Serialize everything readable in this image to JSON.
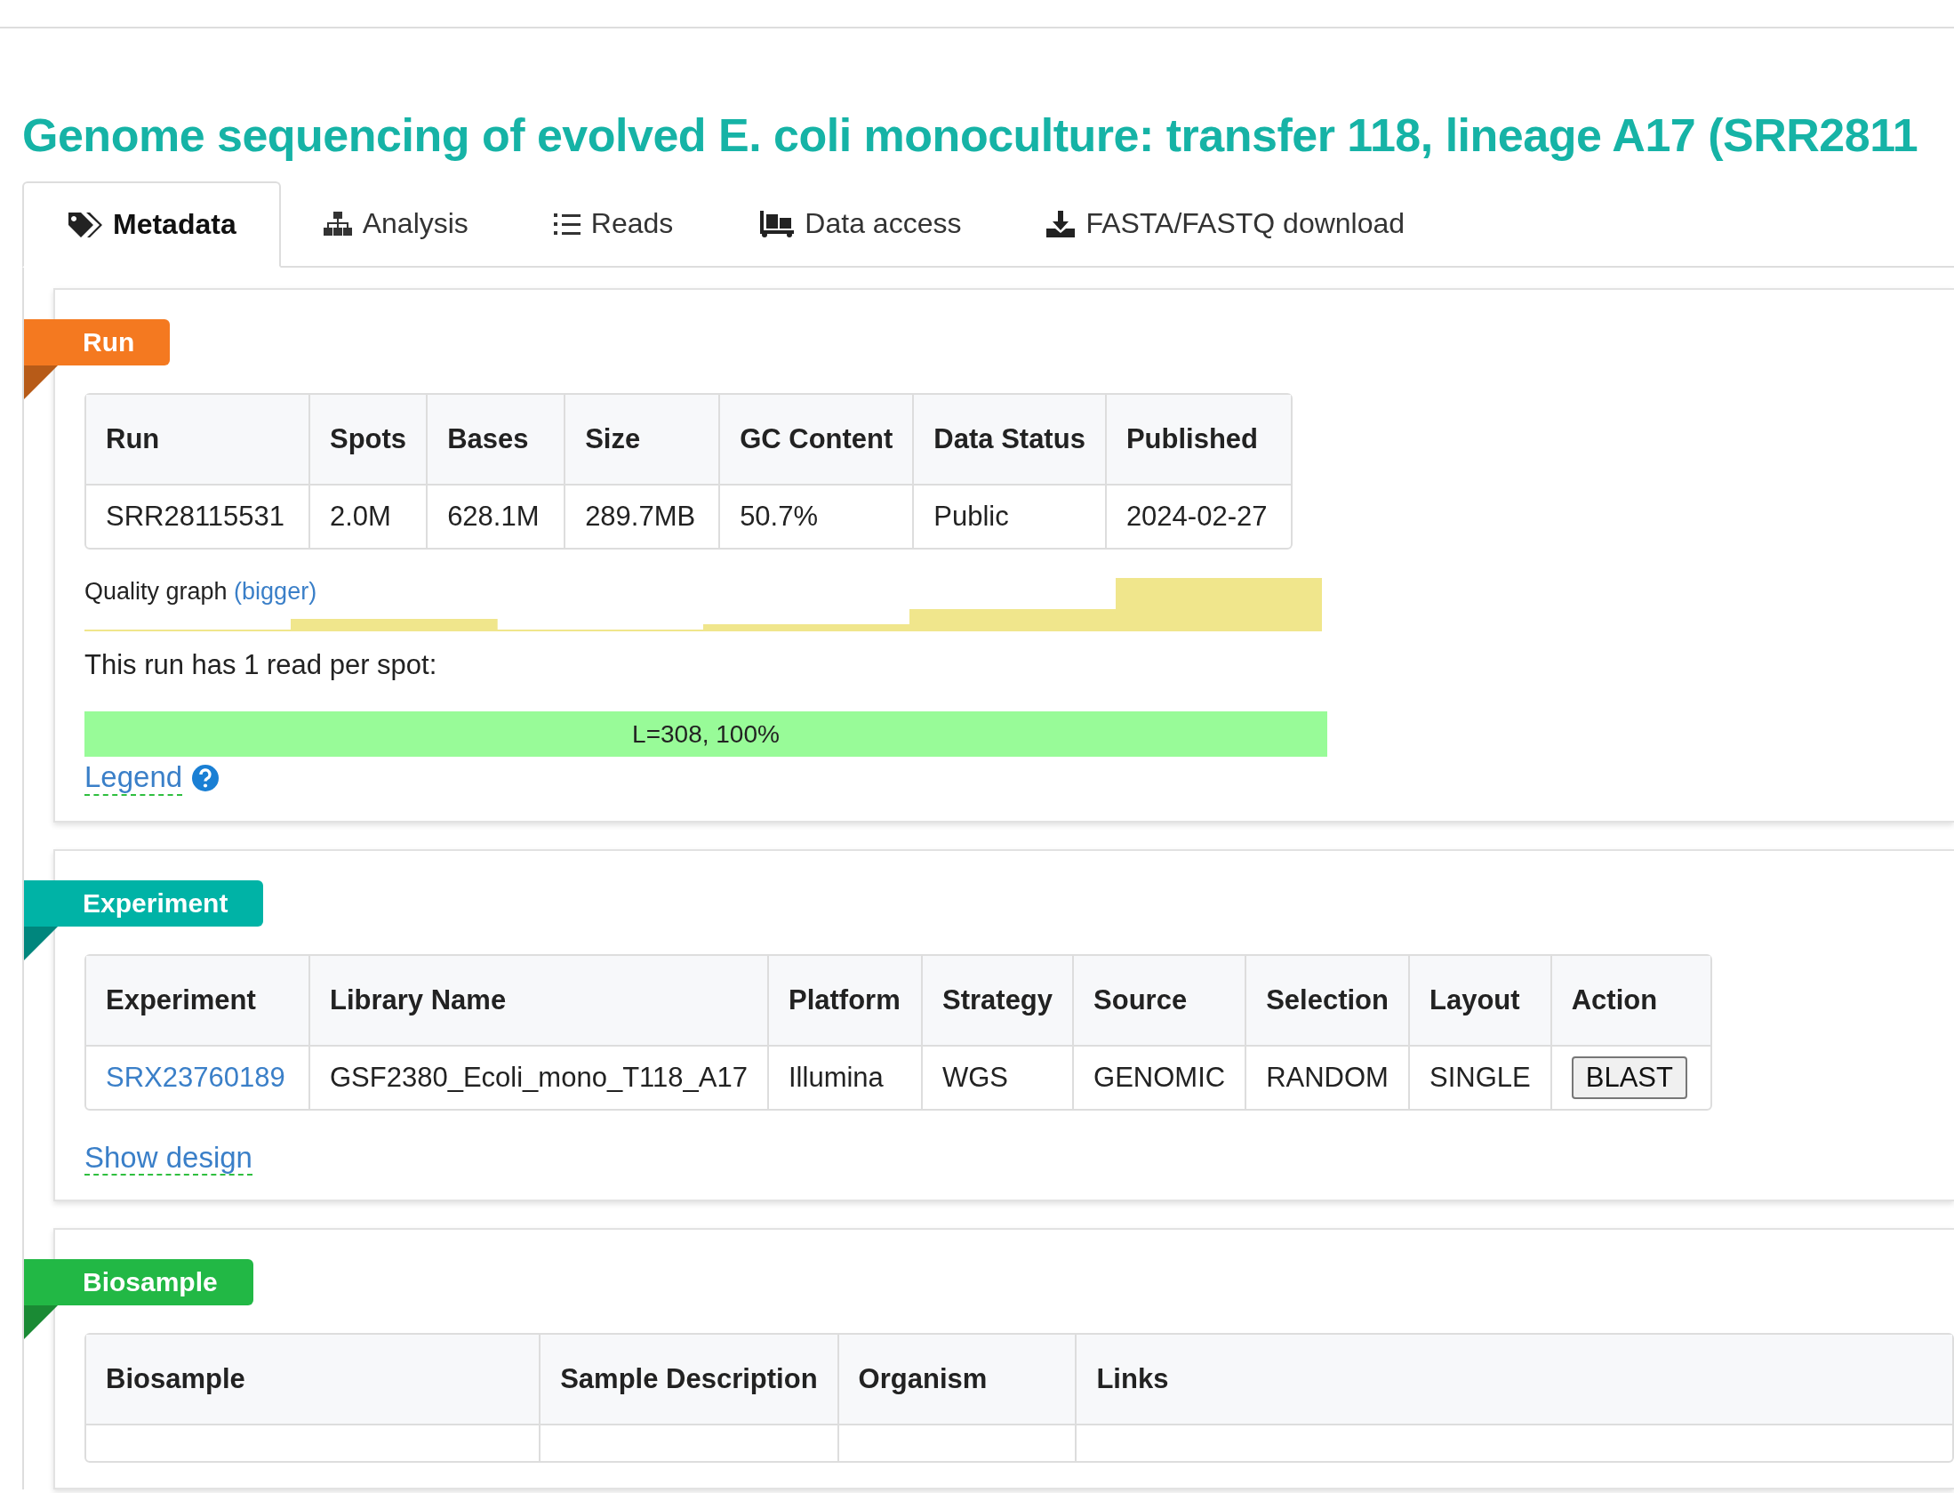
{
  "page_title": "Genome sequencing of evolved E. coli monoculture: transfer 118, lineage A17 (SRR2811",
  "tabs": [
    {
      "label": "Metadata",
      "selected": true
    },
    {
      "label": "Analysis",
      "selected": false
    },
    {
      "label": "Reads",
      "selected": false
    },
    {
      "label": "Data access",
      "selected": false
    },
    {
      "label": "FASTA/FASTQ download",
      "selected": false
    }
  ],
  "sections": [
    {
      "kind": "run",
      "title": "Run",
      "color": "#f47920",
      "table": {
        "columns": [
          "Run",
          "Spots",
          "Bases",
          "Size",
          "GC Content",
          "Data Status",
          "Published"
        ],
        "rows": [
          {
            "cells": [
              {
                "text": "SRR28115531",
                "kind": "text"
              },
              {
                "text": "2.0M",
                "kind": "text"
              },
              {
                "text": "628.1M",
                "kind": "text"
              },
              {
                "text": "289.7MB",
                "kind": "text"
              },
              {
                "text": "50.7%",
                "kind": "text"
              },
              {
                "text": "Public",
                "kind": "text"
              },
              {
                "text": "2024-02-27",
                "kind": "text"
              }
            ]
          }
        ]
      },
      "quality_graph": {
        "label": "Quality graph",
        "link": "(bigger)"
      },
      "reads_text": "This run has 1 read per spot:",
      "read_bar": {
        "label": "L=308, 100%"
      },
      "legend_link": "Legend"
    },
    {
      "kind": "experiment",
      "title": "Experiment",
      "color": "#00b3a6",
      "table": {
        "columns": [
          "Experiment",
          "Library Name",
          "Platform",
          "Strategy",
          "Source",
          "Selection",
          "Layout",
          "Action"
        ],
        "rows": [
          {
            "cells": [
              {
                "text": "SRX23760189",
                "kind": "link"
              },
              {
                "text": "GSF2380_Ecoli_mono_T118_A17",
                "kind": "text"
              },
              {
                "text": "Illumina",
                "kind": "text"
              },
              {
                "text": "WGS",
                "kind": "text"
              },
              {
                "text": "GENOMIC",
                "kind": "text"
              },
              {
                "text": "RANDOM",
                "kind": "text"
              },
              {
                "text": "SINGLE",
                "kind": "text"
              },
              {
                "text": "BLAST",
                "kind": "button"
              }
            ]
          }
        ]
      },
      "design_link": "Show design"
    },
    {
      "kind": "biosample",
      "title": "Biosample",
      "color": "#22b845",
      "table": {
        "columns": [
          "Biosample",
          "Sample Description",
          "Organism",
          "Links"
        ]
      }
    }
  ]
}
